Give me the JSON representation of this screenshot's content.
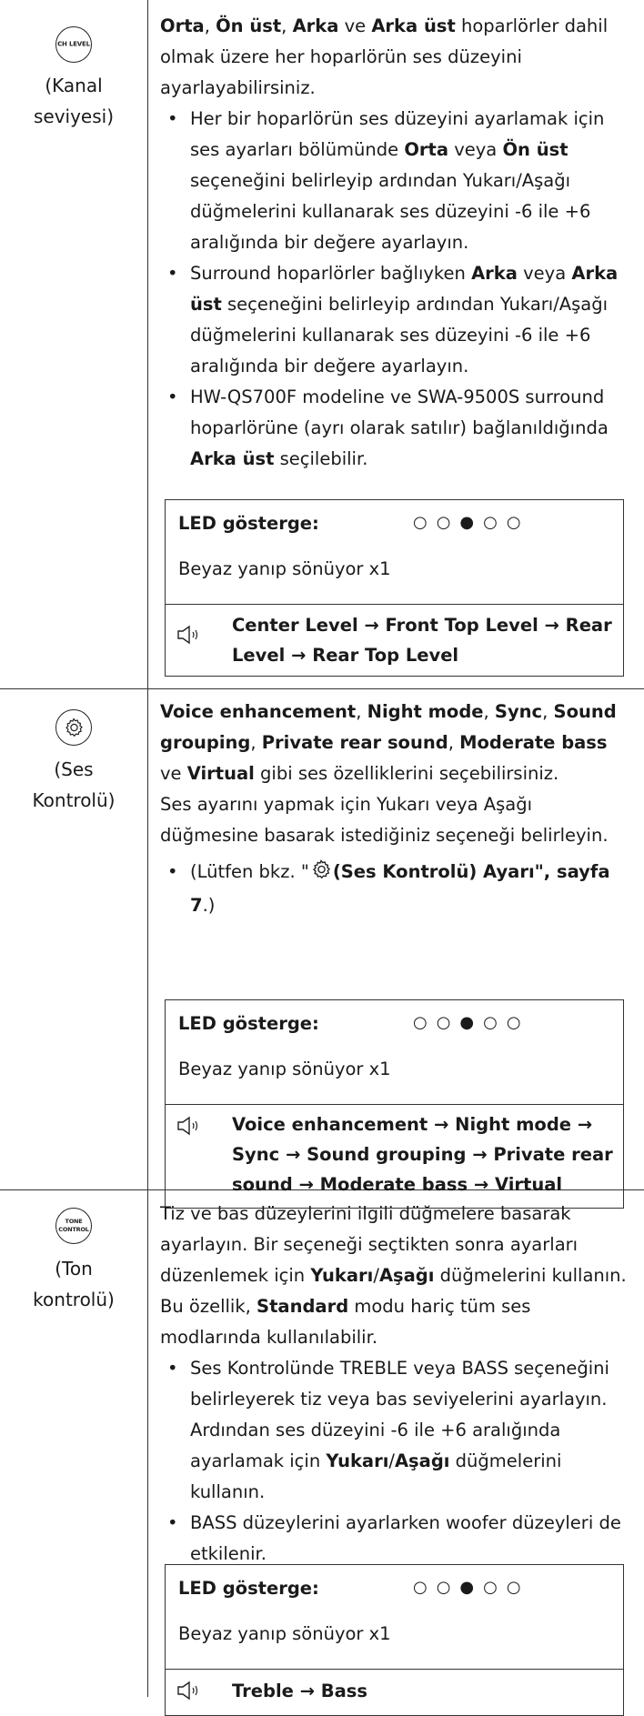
{
  "rows": [
    {
      "icon_text": "CH LEVEL",
      "label_l1": "(Kanal",
      "label_l2": "seviyesi)",
      "desc": [
        "Orta",
        ", ",
        "Ön üst",
        ", ",
        "Arka",
        " ve ",
        "Arka üst",
        " hoparlörler dahil olmak üzere her hoparlörün ses düzeyini ayarlayabilirsiniz."
      ],
      "bullets": [
        [
          "Her bir hoparlörün ses düzeyini ayarlamak için ses ayarları bölümünde ",
          "Orta",
          " veya ",
          "Ön üst",
          " seçeneğini belirleyip ardından Yukarı/Aşağı düğmelerini kullanarak ses düzeyini -6 ile +6 aralığında bir değere ayarlayın."
        ],
        [
          "Surround hoparlörler bağlıyken ",
          "Arka",
          " veya ",
          "Arka üst",
          " seçeneğini belirleyip ardından Yukarı/Aşağı düğmelerini kullanarak ses düzeyini -6 ile +6 aralığında bir değere ayarlayın."
        ],
        [
          "HW-QS700F modeline ve SWA-9500S surround hoparlörüne (ayrı olarak satılır) bağlanıldığında ",
          "Arka üst",
          " seçilebilir."
        ]
      ],
      "led_label": "LED gösterge:",
      "led_dots": "○○●○○",
      "led_status": "Beyaz yanıp sönüyor x1",
      "seq_l1": "Center Level → Front Top Level → Rear",
      "seq_l2": "Level → Rear Top Level"
    },
    {
      "icon_name": "gear-icon",
      "label_l1": "(Ses",
      "label_l2": "Kontrolü)",
      "desc": [
        "Voice enhancement",
        ", ",
        "Night mode",
        ", ",
        "Sync",
        ", ",
        "Sound grouping",
        ", ",
        "Private rear sound",
        ", ",
        "Moderate bass",
        " ve ",
        "Virtual",
        " gibi ses özelliklerini seçebilirsiniz."
      ],
      "desc2": "Ses ayarını yapmak için Yukarı veya Aşağı düğmesine basarak istediğiniz seçeneği belirleyin.",
      "ref_pre": "(Lütfen bkz. \"",
      "ref_bold": "(Ses Kontrolü) Ayarı\", sayfa",
      "ref_page": "7",
      "ref_post": ".)",
      "led_label": "LED gösterge:",
      "led_dots": "○○●○○",
      "led_status": "Beyaz yanıp sönüyor x1",
      "seq_l1": "Voice enhancement → Night mode →",
      "seq_l2": "Sync → Sound grouping → Private rear",
      "seq_l3": "sound → Moderate bass → Virtual"
    },
    {
      "icon_l1": "TONE",
      "icon_l2": "CONTROL",
      "label_l1": "(Ton",
      "label_l2": "kontrolü)",
      "desc": [
        "Tiz ve bas düzeylerini ilgili düğmelere basarak ayarlayın. Bir seçeneği seçtikten sonra ayarları düzenlemek için ",
        "Yukarı",
        "/",
        "Aşağı",
        " düğmelerini kullanın. Bu özellik, ",
        "Standard",
        " modu hariç tüm ses modlarında kullanılabilir."
      ],
      "bullets": [
        [
          "Ses Kontrolünde TREBLE veya BASS seçeneğini belirleyerek tiz veya bas seviyelerini ayarlayın. Ardından ses düzeyini -6 ile +6 aralığında ayarlamak için ",
          "Yukarı",
          "/",
          "Aşağı",
          " düğmelerini kullanın."
        ],
        [
          "BASS düzeylerini ayarlarken woofer düzeyleri de etkilenir."
        ]
      ],
      "led_label": "LED gösterge:",
      "led_dots": "○○●○○",
      "led_status": "Beyaz yanıp sönüyor x1",
      "seq_l1": "Treble → Bass"
    }
  ]
}
